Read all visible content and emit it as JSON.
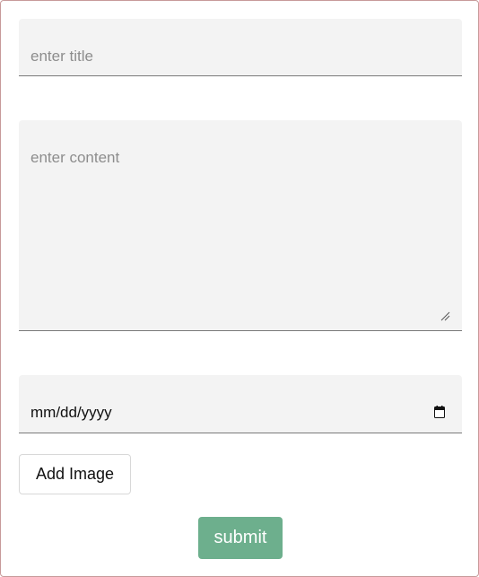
{
  "form": {
    "title_placeholder": "enter title",
    "content_placeholder": "enter content",
    "date_value": "mm/dd/yyyy",
    "add_image_label": "Add Image",
    "submit_label": "submit"
  },
  "icons": {
    "calendar": "calendar-icon",
    "resize": "resize-handle-icon"
  },
  "colors": {
    "field_background": "#f3f3f3",
    "field_underline": "#7a7a7a",
    "submit_background": "#6daf8d",
    "frame_border": "#c79a9a"
  }
}
